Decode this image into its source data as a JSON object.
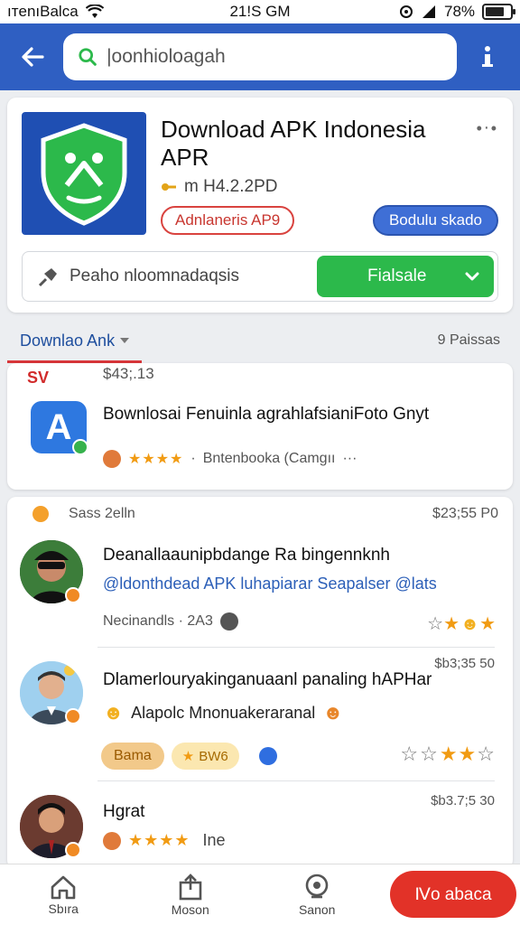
{
  "status_bar": {
    "carrier": "ıтenıBalca",
    "time": "21!S GM",
    "battery": "78%",
    "battery_level": 0.78
  },
  "header": {
    "search_placeholder": "|oonhioloagah"
  },
  "app": {
    "title": "Download APK Indonesia APR",
    "version": "m H4.2.2PD",
    "tag_outline": "Adnlaneris AP9",
    "tag_blue": "Bodulu skado",
    "download_label": "Peaho nloomnadaqsis",
    "download_button": "Fialsale"
  },
  "tabs": {
    "active": "Downlao Ank",
    "count": "9 Paissas"
  },
  "top_post": {
    "brand": "SV",
    "price": "$43;.13",
    "icon_letter": "A",
    "title": "Bownlosai Fenuinla agrahlafsianiFoto Gnyt",
    "source": "Bntenbooka (Camgıı",
    "more": "···"
  },
  "feed": {
    "header_label": "Sass 2elln",
    "header_time": "$23;55 P0",
    "items": [
      {
        "title": "Deanallaaunipbdange Ra bingennknh",
        "subtitle": "@ldonthdead APK luhapiarar Seapalser @lats",
        "meta": "Necinandls · 2A3"
      },
      {
        "title": "Dlamerlouryakinganuaanl panaling hAPHar",
        "subtitle": "Alapolc Mnonuakeraranal",
        "time": "$b3;35 50",
        "chip1": "Bama",
        "chip2": "BW6"
      },
      {
        "title": "Hgrat",
        "time": "$b3.7;5 30",
        "meta": "Ine"
      }
    ]
  },
  "bottom_nav": {
    "items": [
      "Sbıra",
      "Moson",
      "Sanon"
    ],
    "cta": "Ⅳo abaca"
  },
  "colors": {
    "appbar": "#2f5fc2",
    "green": "#2cb94b",
    "red": "#e23228",
    "star": "#f19b13"
  }
}
